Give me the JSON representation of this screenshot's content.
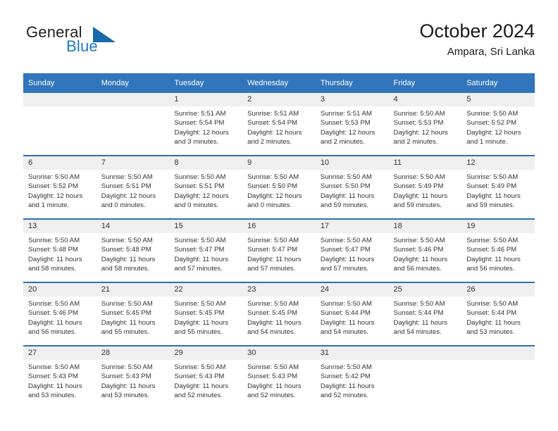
{
  "brand": {
    "word1": "General",
    "word2": "Blue",
    "triangle_color": "#1669ab",
    "blue_color": "#1878c8"
  },
  "header": {
    "title": "October 2024",
    "subtitle": "Ampara, Sri Lanka",
    "header_bg": "#3176bc",
    "row_divider": "#2d6fb5",
    "daynum_bg": "#efefef"
  },
  "weekdays": [
    "Sunday",
    "Monday",
    "Tuesday",
    "Wednesday",
    "Thursday",
    "Friday",
    "Saturday"
  ],
  "weeks": [
    [
      {
        "day": "",
        "empty": true
      },
      {
        "day": "",
        "empty": true
      },
      {
        "day": "1",
        "sunrise": "Sunrise: 5:51 AM",
        "sunset": "Sunset: 5:54 PM",
        "daylight": "Daylight: 12 hours and 3 minutes."
      },
      {
        "day": "2",
        "sunrise": "Sunrise: 5:51 AM",
        "sunset": "Sunset: 5:54 PM",
        "daylight": "Daylight: 12 hours and 2 minutes."
      },
      {
        "day": "3",
        "sunrise": "Sunrise: 5:51 AM",
        "sunset": "Sunset: 5:53 PM",
        "daylight": "Daylight: 12 hours and 2 minutes."
      },
      {
        "day": "4",
        "sunrise": "Sunrise: 5:50 AM",
        "sunset": "Sunset: 5:53 PM",
        "daylight": "Daylight: 12 hours and 2 minutes."
      },
      {
        "day": "5",
        "sunrise": "Sunrise: 5:50 AM",
        "sunset": "Sunset: 5:52 PM",
        "daylight": "Daylight: 12 hours and 1 minute."
      }
    ],
    [
      {
        "day": "6",
        "sunrise": "Sunrise: 5:50 AM",
        "sunset": "Sunset: 5:52 PM",
        "daylight": "Daylight: 12 hours and 1 minute."
      },
      {
        "day": "7",
        "sunrise": "Sunrise: 5:50 AM",
        "sunset": "Sunset: 5:51 PM",
        "daylight": "Daylight: 12 hours and 0 minutes."
      },
      {
        "day": "8",
        "sunrise": "Sunrise: 5:50 AM",
        "sunset": "Sunset: 5:51 PM",
        "daylight": "Daylight: 12 hours and 0 minutes."
      },
      {
        "day": "9",
        "sunrise": "Sunrise: 5:50 AM",
        "sunset": "Sunset: 5:50 PM",
        "daylight": "Daylight: 12 hours and 0 minutes."
      },
      {
        "day": "10",
        "sunrise": "Sunrise: 5:50 AM",
        "sunset": "Sunset: 5:50 PM",
        "daylight": "Daylight: 11 hours and 59 minutes."
      },
      {
        "day": "11",
        "sunrise": "Sunrise: 5:50 AM",
        "sunset": "Sunset: 5:49 PM",
        "daylight": "Daylight: 11 hours and 59 minutes."
      },
      {
        "day": "12",
        "sunrise": "Sunrise: 5:50 AM",
        "sunset": "Sunset: 5:49 PM",
        "daylight": "Daylight: 11 hours and 59 minutes."
      }
    ],
    [
      {
        "day": "13",
        "sunrise": "Sunrise: 5:50 AM",
        "sunset": "Sunset: 5:48 PM",
        "daylight": "Daylight: 11 hours and 58 minutes."
      },
      {
        "day": "14",
        "sunrise": "Sunrise: 5:50 AM",
        "sunset": "Sunset: 5:48 PM",
        "daylight": "Daylight: 11 hours and 58 minutes."
      },
      {
        "day": "15",
        "sunrise": "Sunrise: 5:50 AM",
        "sunset": "Sunset: 5:47 PM",
        "daylight": "Daylight: 11 hours and 57 minutes."
      },
      {
        "day": "16",
        "sunrise": "Sunrise: 5:50 AM",
        "sunset": "Sunset: 5:47 PM",
        "daylight": "Daylight: 11 hours and 57 minutes."
      },
      {
        "day": "17",
        "sunrise": "Sunrise: 5:50 AM",
        "sunset": "Sunset: 5:47 PM",
        "daylight": "Daylight: 11 hours and 57 minutes."
      },
      {
        "day": "18",
        "sunrise": "Sunrise: 5:50 AM",
        "sunset": "Sunset: 5:46 PM",
        "daylight": "Daylight: 11 hours and 56 minutes."
      },
      {
        "day": "19",
        "sunrise": "Sunrise: 5:50 AM",
        "sunset": "Sunset: 5:46 PM",
        "daylight": "Daylight: 11 hours and 56 minutes."
      }
    ],
    [
      {
        "day": "20",
        "sunrise": "Sunrise: 5:50 AM",
        "sunset": "Sunset: 5:46 PM",
        "daylight": "Daylight: 11 hours and 56 minutes."
      },
      {
        "day": "21",
        "sunrise": "Sunrise: 5:50 AM",
        "sunset": "Sunset: 5:45 PM",
        "daylight": "Daylight: 11 hours and 55 minutes."
      },
      {
        "day": "22",
        "sunrise": "Sunrise: 5:50 AM",
        "sunset": "Sunset: 5:45 PM",
        "daylight": "Daylight: 11 hours and 55 minutes."
      },
      {
        "day": "23",
        "sunrise": "Sunrise: 5:50 AM",
        "sunset": "Sunset: 5:45 PM",
        "daylight": "Daylight: 11 hours and 54 minutes."
      },
      {
        "day": "24",
        "sunrise": "Sunrise: 5:50 AM",
        "sunset": "Sunset: 5:44 PM",
        "daylight": "Daylight: 11 hours and 54 minutes."
      },
      {
        "day": "25",
        "sunrise": "Sunrise: 5:50 AM",
        "sunset": "Sunset: 5:44 PM",
        "daylight": "Daylight: 11 hours and 54 minutes."
      },
      {
        "day": "26",
        "sunrise": "Sunrise: 5:50 AM",
        "sunset": "Sunset: 5:44 PM",
        "daylight": "Daylight: 11 hours and 53 minutes."
      }
    ],
    [
      {
        "day": "27",
        "sunrise": "Sunrise: 5:50 AM",
        "sunset": "Sunset: 5:43 PM",
        "daylight": "Daylight: 11 hours and 53 minutes."
      },
      {
        "day": "28",
        "sunrise": "Sunrise: 5:50 AM",
        "sunset": "Sunset: 5:43 PM",
        "daylight": "Daylight: 11 hours and 53 minutes."
      },
      {
        "day": "29",
        "sunrise": "Sunrise: 5:50 AM",
        "sunset": "Sunset: 5:43 PM",
        "daylight": "Daylight: 11 hours and 52 minutes."
      },
      {
        "day": "30",
        "sunrise": "Sunrise: 5:50 AM",
        "sunset": "Sunset: 5:43 PM",
        "daylight": "Daylight: 11 hours and 52 minutes."
      },
      {
        "day": "31",
        "sunrise": "Sunrise: 5:50 AM",
        "sunset": "Sunset: 5:42 PM",
        "daylight": "Daylight: 11 hours and 52 minutes."
      },
      {
        "day": "",
        "empty": true
      },
      {
        "day": "",
        "empty": true
      }
    ]
  ]
}
